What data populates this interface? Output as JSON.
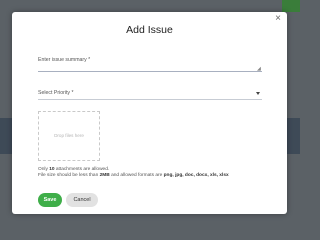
{
  "modal": {
    "title": "Add Issue",
    "close_icon": "close-icon"
  },
  "form": {
    "summary_placeholder": "Enter issue summary *",
    "summary_value": "",
    "priority_placeholder": "Select Priority *",
    "dropzone_text": "Drop files here",
    "attachments_note_prefix": "Only ",
    "attachments_note_count": "10",
    "attachments_note_suffix": " attachments are allowed.",
    "file_note_prefix": "File size should be less than ",
    "file_note_size": "2MB",
    "file_note_middle": " and allowed formats are ",
    "file_note_formats": "png, jpg, doc, docx, xls, xlsx"
  },
  "buttons": {
    "save": "Save",
    "cancel": "Cancel"
  },
  "colors": {
    "save_button": "#3fae49",
    "cancel_button": "#e2e2e2",
    "overlay": "#5b6166"
  }
}
